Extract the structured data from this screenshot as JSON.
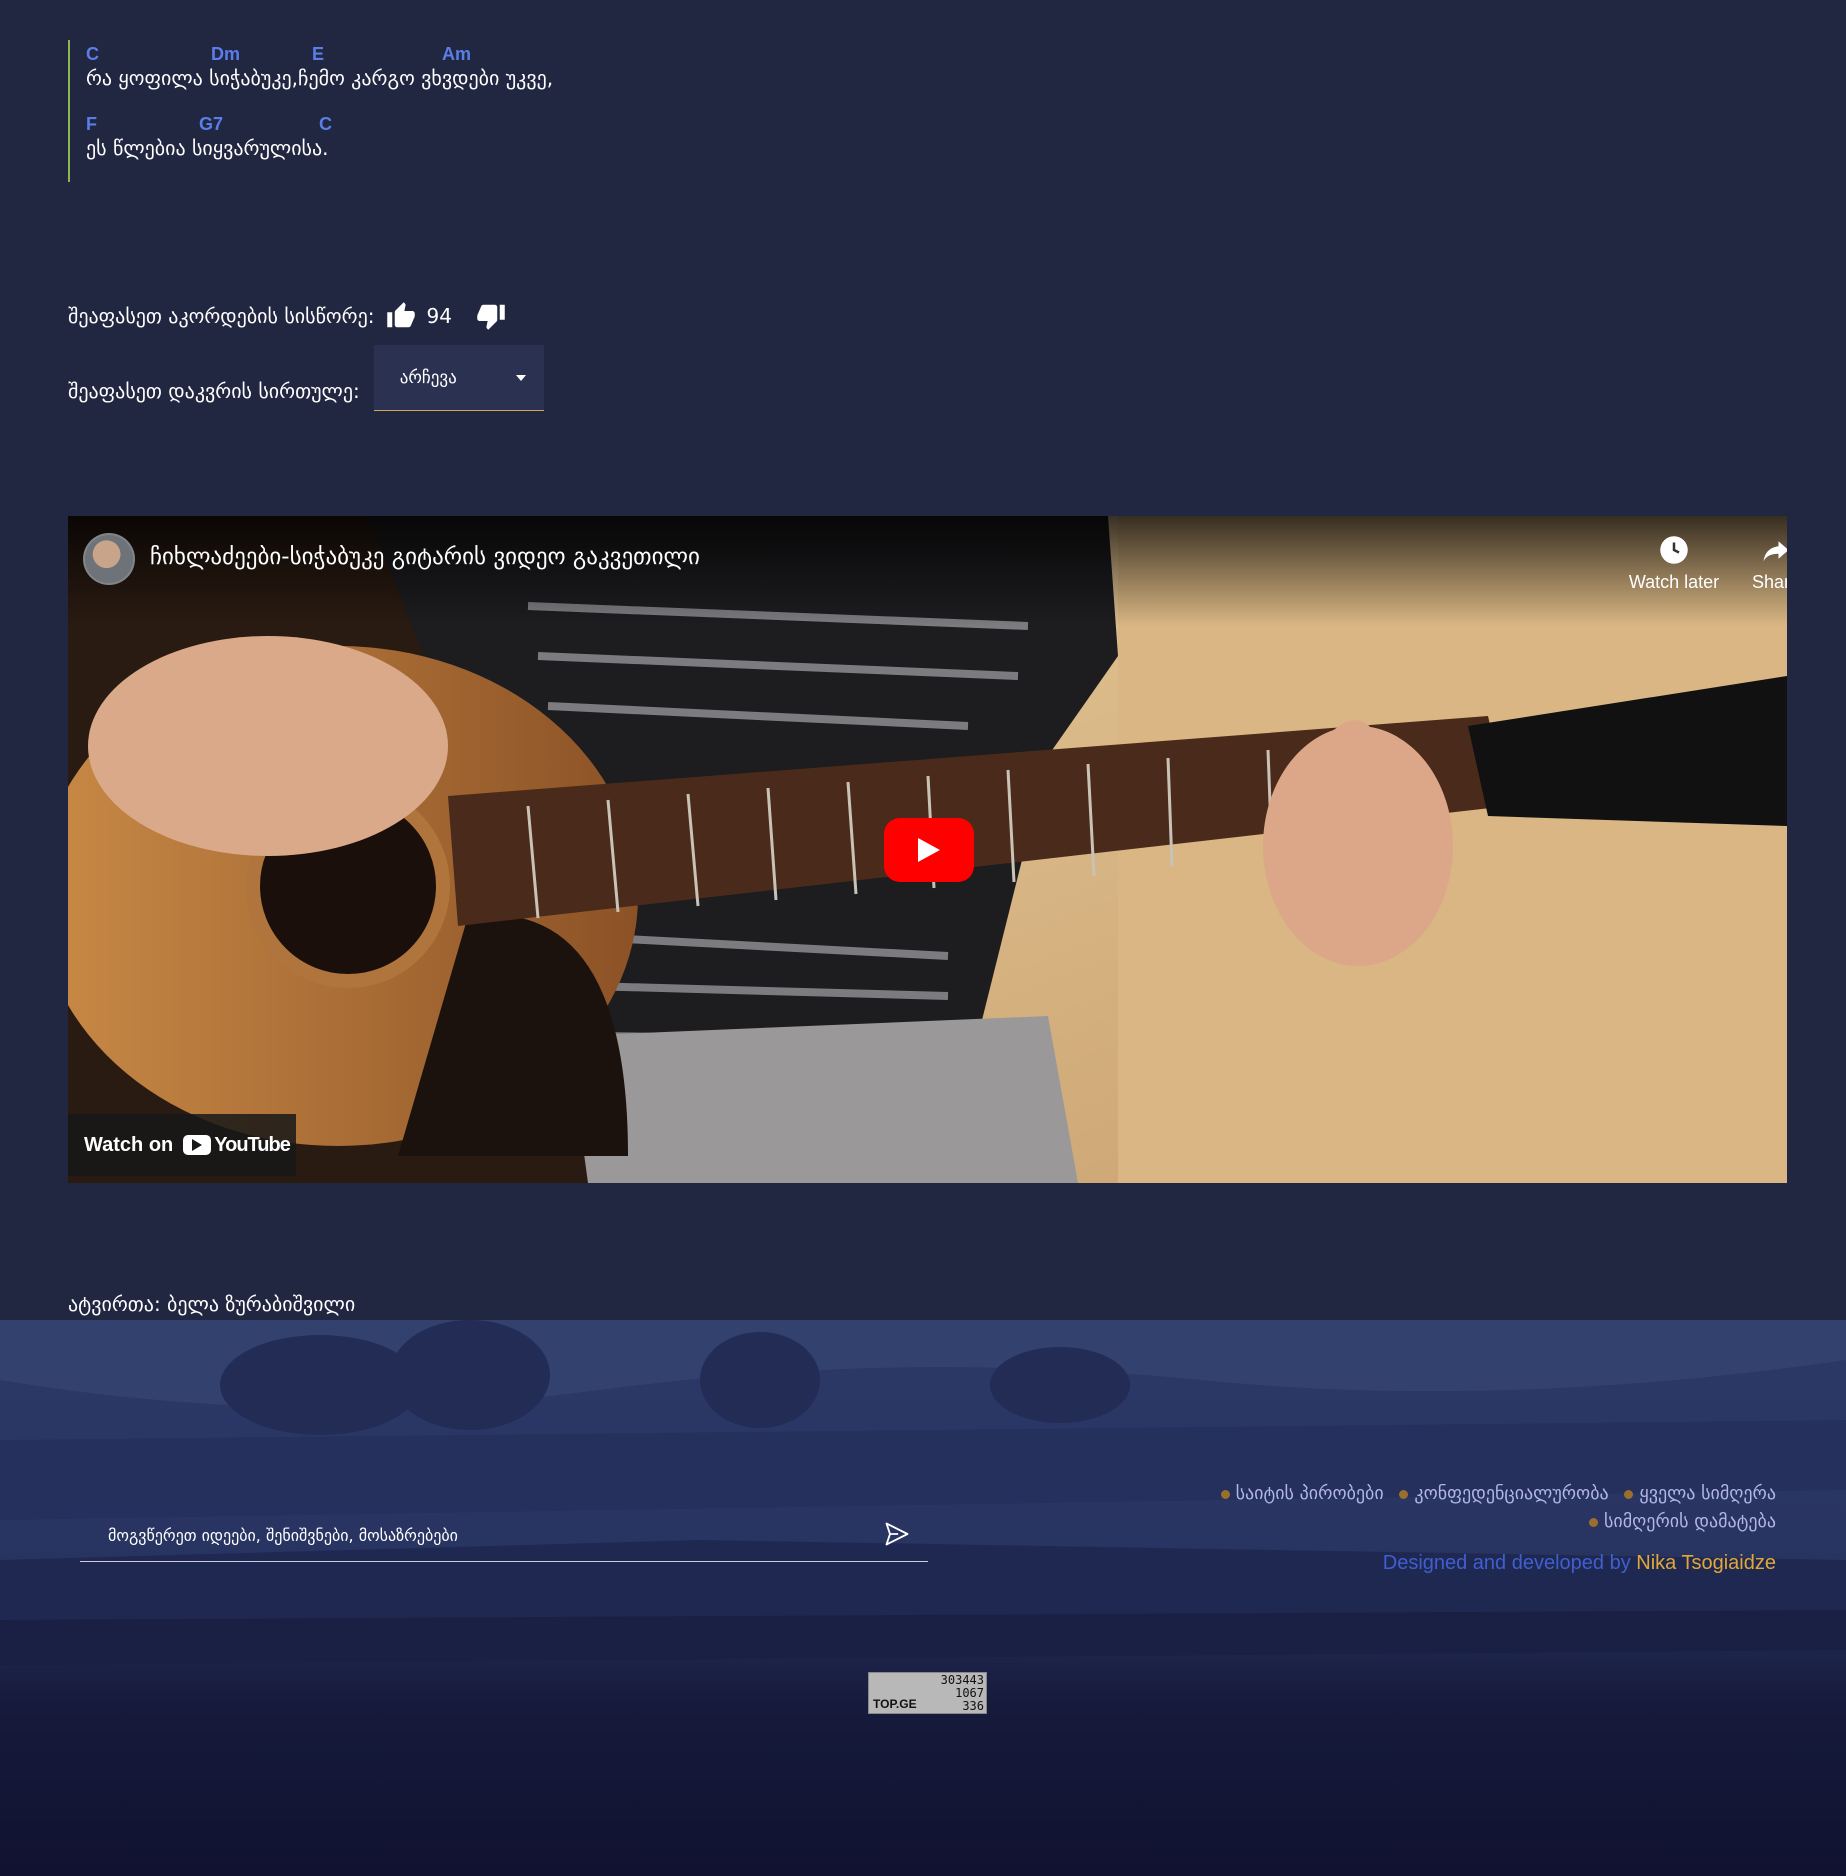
{
  "lyrics": {
    "lines": [
      {
        "chords": [
          {
            "label": "C"
          },
          {
            "label": "Dm"
          },
          {
            "label": "E"
          },
          {
            "label": "Am"
          }
        ],
        "text": "რა ყოფილა სიჭაბუკე,ჩემო კარგო ვხვდები უკვე,"
      },
      {
        "chords": [
          {
            "label": "F"
          },
          {
            "label": "G7"
          },
          {
            "label": "C"
          }
        ],
        "text": "ეს წლებია სიყვარულისა."
      }
    ]
  },
  "rating": {
    "accuracy_label": "შეაფასეთ აკორდების სისწორე:",
    "vote_count": "94",
    "difficulty_label": "შეაფასეთ დაკვრის სირთულე:",
    "difficulty_select": "არჩევა"
  },
  "video": {
    "title": "ჩიხლაძეები-სიჭაბუკე გიტარის ვიდეო გაკვეთილი",
    "watch_later": "Watch later",
    "share": "Share",
    "watch_on": "Watch on",
    "youtube": "YouTube"
  },
  "author": "ატვირთა: ბელა ზურაბიშვილი",
  "footer": {
    "feedback_placeholder": "მოგვწერეთ იდეები, შენიშვნები, მოსაზრებები",
    "links": [
      "საიტის პირობები",
      "კონფედენციალურობა",
      "ყველა სიმღერა",
      "სიმღერის დამატება"
    ],
    "credit_prefix": "Designed and developed by ",
    "credit_name": "Nika Tsogiaidze",
    "counter": {
      "brand": "TOP.GE",
      "values": [
        "303443",
        "1067",
        "336"
      ]
    }
  },
  "colors": {
    "background": "#222741",
    "chord": "#5b7de8",
    "accent": "#e0a83a",
    "youtube_red": "#ff0000"
  }
}
